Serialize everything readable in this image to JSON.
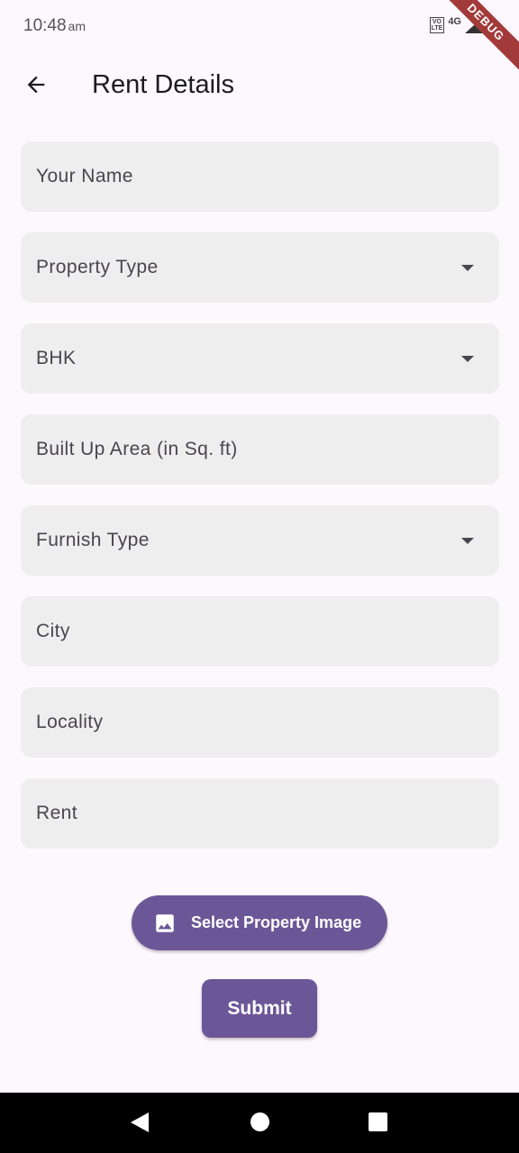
{
  "status_bar": {
    "time": "10:48",
    "ampm": "am",
    "volte": "VO\nLTE",
    "network": "4G",
    "debug_label": "DEBUG"
  },
  "app_bar": {
    "title": "Rent Details",
    "back_icon": "arrow-back-icon"
  },
  "form": {
    "fields": [
      {
        "label": "Your Name",
        "type": "text"
      },
      {
        "label": "Property Type",
        "type": "dropdown"
      },
      {
        "label": "BHK",
        "type": "dropdown"
      },
      {
        "label": "Built Up Area (in Sq. ft)",
        "type": "text"
      },
      {
        "label": "Furnish Type",
        "type": "dropdown"
      },
      {
        "label": "City",
        "type": "text"
      },
      {
        "label": "Locality",
        "type": "text"
      },
      {
        "label": "Rent",
        "type": "text"
      }
    ]
  },
  "actions": {
    "select_image_label": "Select Property Image",
    "select_image_icon": "image-icon",
    "submit_label": "Submit"
  },
  "colors": {
    "background": "#fdf7fe",
    "field_fill": "#eeeeee",
    "primary": "#6b5797",
    "text": "#49454f"
  },
  "nav_bar": {
    "icons": [
      "nav-back-icon",
      "nav-home-icon",
      "nav-recents-icon"
    ]
  }
}
